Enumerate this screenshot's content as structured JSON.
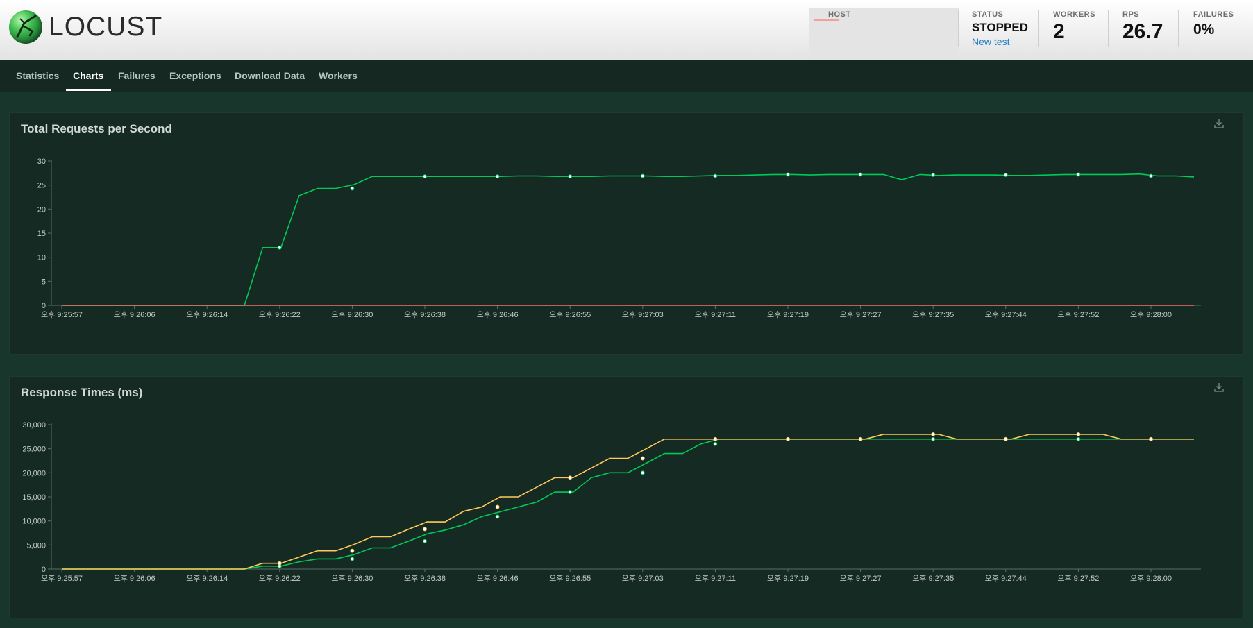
{
  "header": {
    "logo_text": "LOCUST",
    "host": {
      "label": "HOST",
      "value": ""
    },
    "status": {
      "label": "STATUS",
      "value": "STOPPED",
      "link": "New test"
    },
    "workers": {
      "label": "WORKERS",
      "value": "2"
    },
    "rps": {
      "label": "RPS",
      "value": "26.7"
    },
    "failures": {
      "label": "FAILURES",
      "value": "0%"
    }
  },
  "nav": {
    "tabs": [
      {
        "label": "Statistics",
        "active": false
      },
      {
        "label": "Charts",
        "active": true
      },
      {
        "label": "Failures",
        "active": false
      },
      {
        "label": "Exceptions",
        "active": false
      },
      {
        "label": "Download Data",
        "active": false
      },
      {
        "label": "Workers",
        "active": false
      }
    ]
  },
  "icons": {
    "download": "download-icon",
    "logo": "locust-logo-icon"
  },
  "colors": {
    "background": "#18362b",
    "panel": "#152a22",
    "green_line": "#00ca5a",
    "yellow_line": "#ffca5a",
    "red_line": "#ff6d6d",
    "link": "#1f7fc4"
  },
  "chart_data": [
    {
      "type": "line",
      "title": "Total Requests per Second",
      "categories": [
        "오후 9:25:57",
        "오후 9:26:06",
        "오후 9:26:14",
        "오후 9:26:22",
        "오후 9:26:30",
        "오후 9:26:38",
        "오후 9:26:46",
        "오후 9:26:55",
        "오후 9:27:03",
        "오후 9:27:11",
        "오후 9:27:19",
        "오후 9:27:27",
        "오후 9:27:35",
        "오후 9:27:44",
        "오후 9:27:52",
        "오후 9:28:00"
      ],
      "yticks": [
        "0",
        "5",
        "10",
        "15",
        "20",
        "25",
        "30"
      ],
      "ylim": [
        0,
        30
      ],
      "series": [
        {
          "color": "#00ca5a",
          "values": [
            0,
            0,
            0,
            12,
            24.3,
            26.8,
            26.8,
            26.8,
            26.9,
            26.9,
            27.2,
            27.2,
            27.1,
            27.1,
            27.2,
            26.9
          ],
          "dense": [
            0,
            0,
            0,
            0,
            0,
            0,
            0,
            0,
            0,
            0,
            0,
            12,
            12,
            22.8,
            24.3,
            24.3,
            25.1,
            26.8,
            26.8,
            26.8,
            26.8,
            26.8,
            26.8,
            26.8,
            26.8,
            26.9,
            26.9,
            26.8,
            26.8,
            26.8,
            26.9,
            26.9,
            26.9,
            26.8,
            26.8,
            26.9,
            27,
            27,
            27.1,
            27.2,
            27.2,
            27.1,
            27.2,
            27.2,
            27.2,
            27.2,
            26.1,
            27.2,
            27,
            27.1,
            27.1,
            27.1,
            27,
            27,
            27.1,
            27.2,
            27.2,
            27.2,
            27.2,
            27.3,
            26.9,
            26.9,
            26.7
          ]
        },
        {
          "color": "#ff6d6d",
          "values": [
            0,
            0,
            0,
            0,
            0,
            0,
            0,
            0,
            0,
            0,
            0,
            0,
            0,
            0,
            0,
            0
          ],
          "dense": [
            0,
            0
          ]
        }
      ]
    },
    {
      "type": "line",
      "title": "Response Times (ms)",
      "categories": [
        "오후 9:25:57",
        "오후 9:26:06",
        "오후 9:26:14",
        "오후 9:26:22",
        "오후 9:26:30",
        "오후 9:26:38",
        "오후 9:26:46",
        "오후 9:26:55",
        "오후 9:27:03",
        "오후 9:27:11",
        "오후 9:27:19",
        "오후 9:27:27",
        "오후 9:27:35",
        "오후 9:27:44",
        "오후 9:27:52",
        "오후 9:28:00"
      ],
      "yticks": [
        "0",
        "5,000",
        "10,000",
        "15,000",
        "20,000",
        "25,000",
        "30,000"
      ],
      "ylim": [
        0,
        30000
      ],
      "series": [
        {
          "color": "#00ca5a",
          "values": [
            0,
            0,
            0,
            600,
            2100,
            5800,
            10900,
            16000,
            20000,
            26000,
            27000,
            27000,
            27000,
            27000,
            27000,
            27000
          ],
          "dense": [
            0,
            0,
            0,
            0,
            0,
            0,
            0,
            0,
            0,
            0,
            0,
            600,
            600,
            1500,
            2100,
            2100,
            3000,
            4400,
            4400,
            5800,
            7300,
            8100,
            9200,
            10900,
            11900,
            12900,
            13900,
            16000,
            16000,
            19000,
            20000,
            20000,
            22000,
            24000,
            24000,
            26000,
            27000,
            27000,
            27000,
            27000,
            27000,
            27000,
            27000,
            27000,
            27000,
            27000,
            27000,
            27000,
            27000,
            27000,
            27000,
            27000,
            27000,
            27000,
            27000,
            27000,
            27000,
            27000,
            27000,
            27000,
            27000,
            27000,
            27000
          ]
        },
        {
          "color": "#ffca5a",
          "values": [
            0,
            0,
            0,
            1200,
            3800,
            8300,
            12900,
            19000,
            23000,
            27000,
            27000,
            27000,
            28000,
            27000,
            28000,
            27000
          ],
          "dense": [
            0,
            0,
            0,
            0,
            0,
            0,
            0,
            0,
            0,
            0,
            0,
            1200,
            1200,
            2500,
            3800,
            3800,
            5100,
            6700,
            6700,
            8300,
            9800,
            9800,
            12000,
            12900,
            15000,
            15000,
            17000,
            19000,
            19000,
            21000,
            23000,
            23000,
            25000,
            27000,
            27000,
            27000,
            27000,
            27000,
            27000,
            27000,
            27000,
            27000,
            27000,
            27000,
            27000,
            28000,
            28000,
            28000,
            28000,
            27000,
            27000,
            27000,
            27000,
            28000,
            28000,
            28000,
            28000,
            28000,
            27000,
            27000,
            27000,
            27000,
            27000
          ]
        }
      ]
    }
  ]
}
